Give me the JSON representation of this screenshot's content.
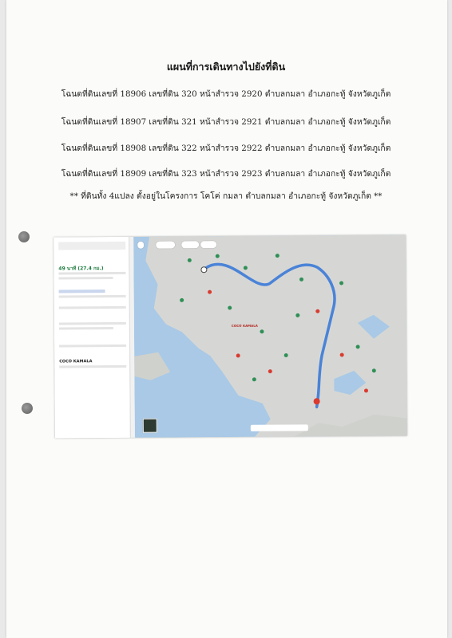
{
  "document": {
    "title": "แผนที่การเดินทางไปยังที่ดิน",
    "lines": [
      "โฉนดที่ดินเลขที่ 18906 เลขที่ดิน 320 หน้าสำรวจ 2920 ตำบลกมลา อำเภอกะทู้ จังหวัดภูเก็ต",
      "โฉนดที่ดินเลขที่ 18907 เลขที่ดิน 321 หน้าสำรวจ 2921 ตำบลกมลา อำเภอกะทู้ จังหวัดภูเก็ต",
      "โฉนดที่ดินเลขที่ 18908 เลขที่ดิน 322 หน้าสำรวจ 2922 ตำบลกมลา อำเภอกะทู้ จังหวัดภูเก็ต",
      "โฉนดที่ดินเลขที่ 18909 เลขที่ดิน 323 หน้าสำรวจ 2923 ตำบลกมลา อำเภอกะทู้ จังหวัดภูเก็ต"
    ],
    "note": "** ที่ดินทั้ง 4แปลง ตั้งอยู่ในโครงการ โคโค่ กมลา ตำบลกมลา อำเภอกะทู้ จังหวัดภูเก็ต **"
  },
  "map_screenshot": {
    "duration": "49 นาที (27.4 กม.)",
    "destination_label": "COCO KAMALA",
    "panel_place": "COCO KAMALA",
    "colors": {
      "route": "#4a83d8",
      "sea": "#a9c9e6",
      "land": "#d6d7d4",
      "pin_green": "#2f8f56",
      "pin_red": "#d93b30"
    }
  }
}
